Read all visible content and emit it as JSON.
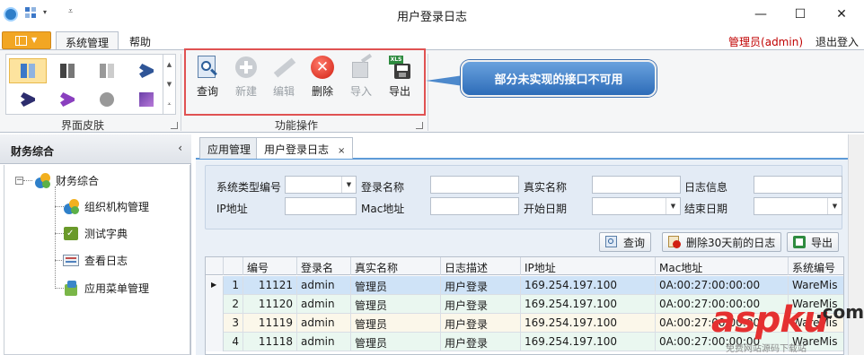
{
  "window": {
    "title": "用户登录日志",
    "minimize_glyph": "—",
    "maximize_glyph": "☐",
    "close_glyph": "✕"
  },
  "quick_access": {
    "dropdown_glyph": "▾",
    "more_glyph": "⩡"
  },
  "ribbon_tabs": [
    {
      "label": "系统管理",
      "active": true
    },
    {
      "label": "帮助",
      "active": false
    }
  ],
  "user": {
    "label": "管理员(admin)",
    "logout": "退出登入",
    "color": "#c00000"
  },
  "skin_group": {
    "label": "界面皮肤",
    "items": [
      "skin-office-blue",
      "skin-office-black",
      "skin-office-silver",
      "skin-vs-blue",
      "skin-vs-dark",
      "skin-vs-purple",
      "skin-seven",
      "skin-metro"
    ]
  },
  "function_group": {
    "label": "功能操作",
    "buttons": [
      {
        "label": "查询",
        "icon": "search-doc-icon",
        "enabled": true
      },
      {
        "label": "新建",
        "icon": "plus-circle-icon",
        "enabled": false
      },
      {
        "label": "编辑",
        "icon": "pencil-icon",
        "enabled": false
      },
      {
        "label": "删除",
        "icon": "red-x-icon",
        "enabled": true
      },
      {
        "label": "导入",
        "icon": "import-icon",
        "enabled": false
      },
      {
        "label": "导出",
        "icon": "excel-export-icon",
        "enabled": true
      }
    ]
  },
  "callout": {
    "text": "部分未实现的接口不可用",
    "color": "#3d7cc9"
  },
  "left_panel": {
    "title": "财务综合",
    "collapse_glyph": "‹",
    "tree": {
      "root": "财务综合",
      "expander": "−",
      "children": [
        "组织机构管理",
        "测试字典",
        "查看日志",
        "应用菜单管理"
      ]
    }
  },
  "doc_tabs": [
    {
      "label": "应用管理",
      "active": false
    },
    {
      "label": "用户登录日志",
      "active": true,
      "close": "×"
    }
  ],
  "search_form": {
    "fields": [
      {
        "label": "系统类型编号",
        "value": "",
        "type": "dropdown"
      },
      {
        "label": "登录名称",
        "value": "",
        "type": "text"
      },
      {
        "label": "真实名称",
        "value": "",
        "type": "text"
      },
      {
        "label": "日志信息",
        "value": "",
        "type": "text"
      },
      {
        "label": "IP地址",
        "value": "",
        "type": "text"
      },
      {
        "label": "Mac地址",
        "value": "",
        "type": "text"
      },
      {
        "label": "开始日期",
        "value": "",
        "type": "date"
      },
      {
        "label": "结束日期",
        "value": "",
        "type": "date"
      }
    ],
    "dropdown_glyph": "▼"
  },
  "actions": {
    "query": "查询",
    "delete_old": "删除30天前的日志",
    "export": "导出"
  },
  "grid": {
    "columns": [
      "编号",
      "登录名",
      "真实名称",
      "日志描述",
      "IP地址",
      "Mac地址",
      "系统编号"
    ],
    "current_row_glyph": "▶",
    "rows": [
      {
        "n": "1",
        "id": "11121",
        "login": "admin",
        "name": "管理员",
        "desc": "用户登录",
        "ip": "169.254.197.100",
        "mac": "0A:00:27:00:00:00",
        "sys": "WareMis"
      },
      {
        "n": "2",
        "id": "11120",
        "login": "admin",
        "name": "管理员",
        "desc": "用户登录",
        "ip": "169.254.197.100",
        "mac": "0A:00:27:00:00:00",
        "sys": "WareMis"
      },
      {
        "n": "3",
        "id": "11119",
        "login": "admin",
        "name": "管理员",
        "desc": "用户登录",
        "ip": "169.254.197.100",
        "mac": "0A:00:27:00:00:00",
        "sys": "WareMis"
      },
      {
        "n": "4",
        "id": "11118",
        "login": "admin",
        "name": "管理员",
        "desc": "用户登录",
        "ip": "169.254.197.100",
        "mac": "0A:00:27:00:00:00",
        "sys": "WareMis"
      }
    ]
  },
  "watermark": {
    "brand": "aspku",
    "suffix": ".com",
    "sub": "免费网站源码下载站"
  },
  "colors": {
    "file_button": "#f2a623",
    "tab_accent": "#5d9bd8",
    "selected_row": "#cfe3f7",
    "highlight_box": "#e05252"
  }
}
